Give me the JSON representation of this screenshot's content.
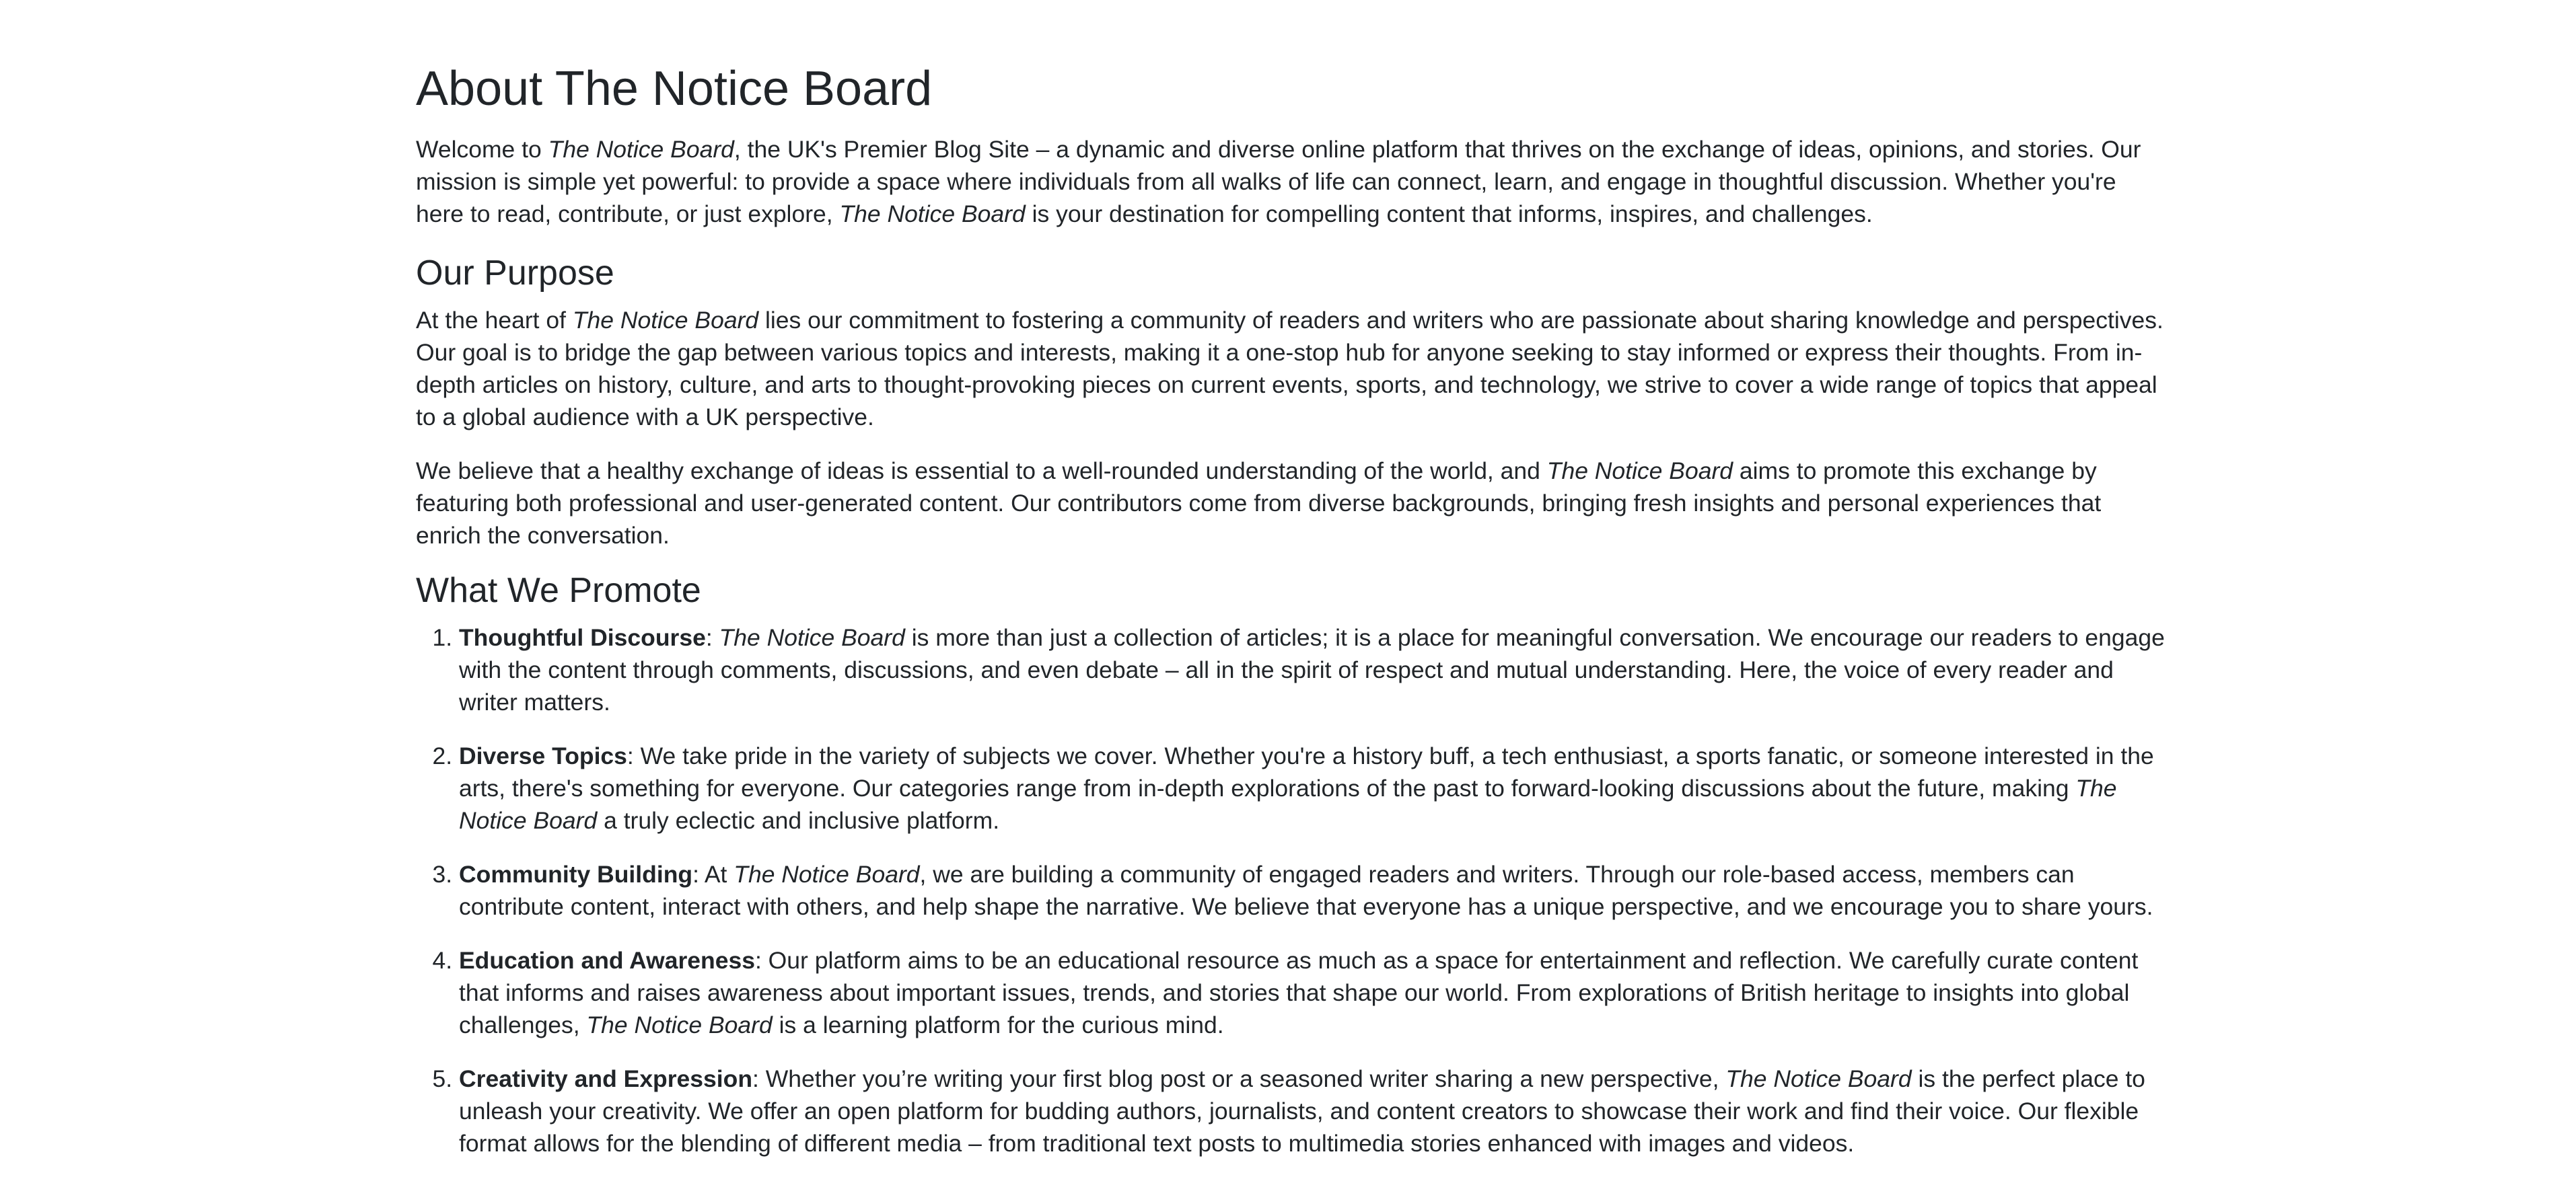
{
  "page": {
    "title": "About The Notice Board",
    "brand": "The Notice Board"
  },
  "intro": {
    "welcome_prefix": "Welcome to ",
    "welcome_text": ", the UK's Premier Blog Site – a dynamic and diverse online platform that thrives on the exchange of ideas, opinions, and stories. Our mission is simple yet powerful: to provide a space where individuals from all walks of life can connect, learn, and engage in thoughtful discussion. Whether you're here to read, contribute, or just explore, ",
    "welcome_suffix": " is your destination for compelling content that informs, inspires, and challenges."
  },
  "purpose": {
    "heading": "Our Purpose",
    "p1_prefix": "At the heart of ",
    "p1_text": " lies our commitment to fostering a community of readers and writers who are passionate about sharing knowledge and perspectives. Our goal is to bridge the gap between various topics and interests, making it a one-stop hub for anyone seeking to stay informed or express their thoughts. From in-depth articles on history, culture, and arts to thought-provoking pieces on current events, sports, and technology, we strive to cover a wide range of topics that appeal to a global audience with a UK perspective.",
    "p2_prefix": "We believe that a healthy exchange of ideas is essential to a well-rounded understanding of the world, and ",
    "p2_text": " aims to promote this exchange by featuring both professional and user-generated content. Our contributors come from diverse backgrounds, bringing fresh insights and personal experiences that enrich the conversation."
  },
  "promote": {
    "heading": "What We Promote",
    "items": [
      {
        "title": "Thoughtful Discourse",
        "colon": ": ",
        "mid": " is more than just a collection of articles; it is a place for meaningful conversation. We encourage our readers to engage with the content through comments, discussions, and even debate – all in the spirit of respect and mutual understanding. Here, the voice of every reader and writer matters."
      },
      {
        "title": "Diverse Topics",
        "text": ": We take pride in the variety of subjects we cover. Whether you're a history buff, a tech enthusiast, a sports fanatic, or someone interested in the arts, there's something for everyone. Our categories range from in-depth explorations of the past to forward-looking discussions about the future, making ",
        "suffix": " a truly eclectic and inclusive platform."
      },
      {
        "title": "Community Building",
        "text": ": At ",
        "suffix": ", we are building a community of engaged readers and writers. Through our role-based access, members can contribute content, interact with others, and help shape the narrative. We believe that everyone has a unique perspective, and we encourage you to share yours."
      },
      {
        "title": "Education and Awareness",
        "text": ": Our platform aims to be an educational resource as much as a space for entertainment and reflection. We carefully curate content that informs and raises awareness about important issues, trends, and stories that shape our world. From explorations of British heritage to insights into global challenges, ",
        "suffix": " is a learning platform for the curious mind."
      },
      {
        "title": "Creativity and Expression",
        "text": ": Whether you’re writing your first blog post or a seasoned writer sharing a new perspective, ",
        "suffix": " is the perfect place to unleash your creativity. We offer an open platform for budding authors, journalists, and content creators to showcase their work and find their voice. Our flexible format allows for the blending of different media – from traditional text posts to multimedia stories enhanced with images and videos."
      }
    ]
  }
}
